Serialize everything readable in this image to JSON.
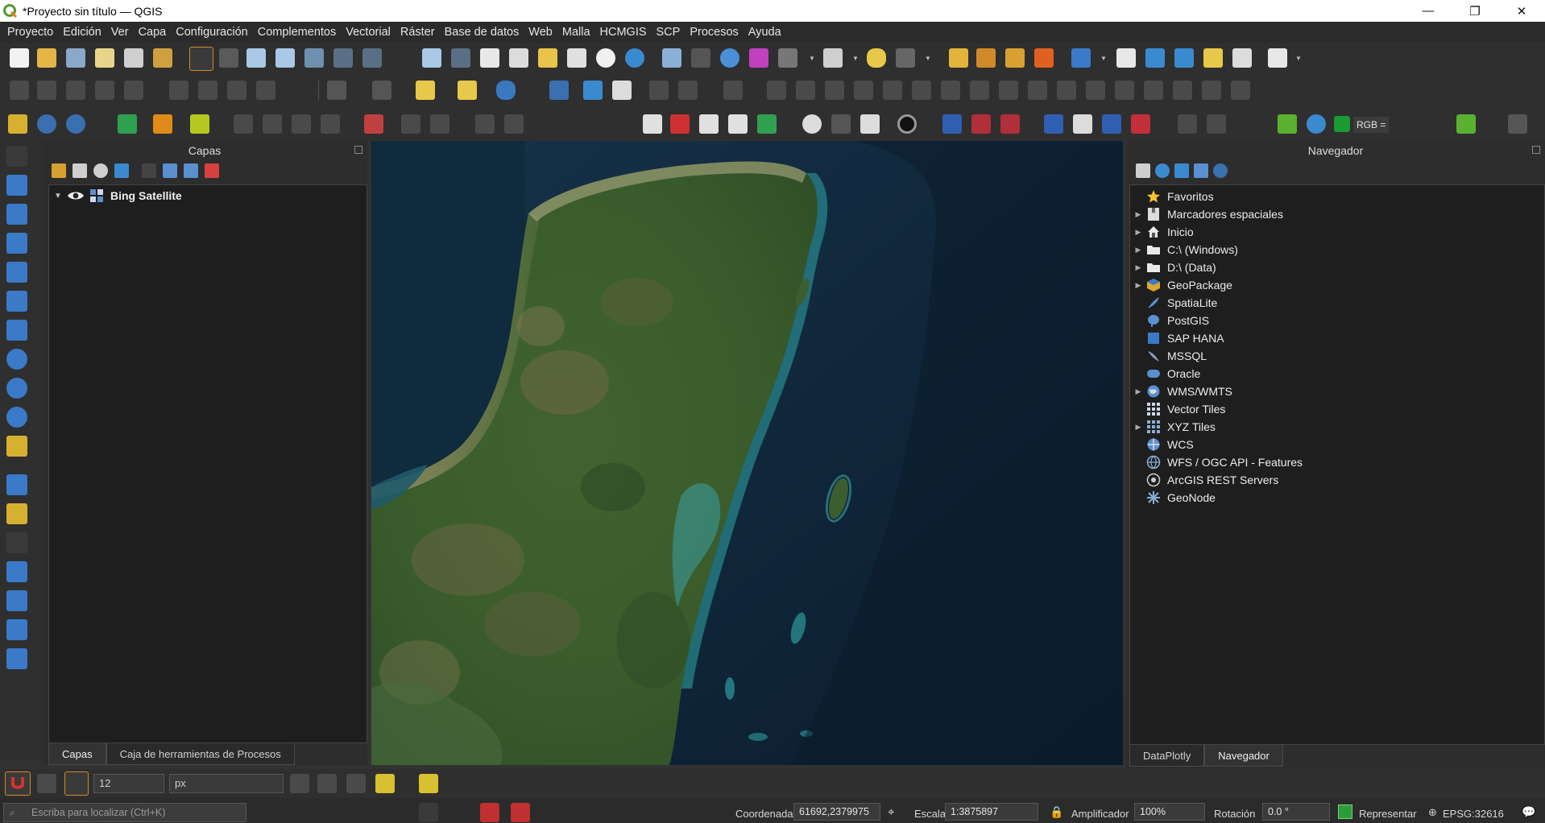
{
  "window": {
    "title": "*Proyecto sin título — QGIS",
    "controls": {
      "minimize": "—",
      "restore": "❐",
      "close": "✕"
    }
  },
  "menubar": {
    "items": [
      "Proyecto",
      "Edición",
      "Ver",
      "Capa",
      "Configuración",
      "Complementos",
      "Vectorial",
      "Ráster",
      "Base de datos",
      "Web",
      "Malla",
      "HCMGIS",
      "SCP",
      "Procesos",
      "Ayuda"
    ]
  },
  "toolbar": {
    "rgb_label": "RGB ="
  },
  "layers_panel": {
    "title": "Capas",
    "layers": [
      {
        "name": "Bing Satellite",
        "visible": true
      }
    ],
    "tabs": [
      "Capas",
      "Caja de herramientas de Procesos"
    ]
  },
  "browser_panel": {
    "title": "Navegador",
    "items": [
      {
        "label": "Favoritos",
        "icon": "star-icon",
        "expandable": false
      },
      {
        "label": "Marcadores espaciales",
        "icon": "bookmark-icon",
        "expandable": true
      },
      {
        "label": "Inicio",
        "icon": "home-icon",
        "expandable": true
      },
      {
        "label": "C:\\ (Windows)",
        "icon": "folder-icon",
        "expandable": true
      },
      {
        "label": "D:\\ (Data)",
        "icon": "folder-icon",
        "expandable": true
      },
      {
        "label": "GeoPackage",
        "icon": "geopackage-icon",
        "expandable": true
      },
      {
        "label": "SpatiaLite",
        "icon": "feather-icon",
        "expandable": false
      },
      {
        "label": "PostGIS",
        "icon": "elephant-icon",
        "expandable": false
      },
      {
        "label": "SAP HANA",
        "icon": "database-icon",
        "expandable": false
      },
      {
        "label": "MSSQL",
        "icon": "mssql-icon",
        "expandable": false
      },
      {
        "label": "Oracle",
        "icon": "oracle-icon",
        "expandable": false
      },
      {
        "label": "WMS/WMTS",
        "icon": "globe-icon",
        "expandable": true
      },
      {
        "label": "Vector Tiles",
        "icon": "grid-icon",
        "expandable": false
      },
      {
        "label": "XYZ Tiles",
        "icon": "grid-icon",
        "expandable": true
      },
      {
        "label": "WCS",
        "icon": "globe-icon",
        "expandable": false
      },
      {
        "label": "WFS / OGC API - Features",
        "icon": "globe-icon",
        "expandable": false
      },
      {
        "label": "ArcGIS REST Servers",
        "icon": "globe-icon",
        "expandable": false
      },
      {
        "label": "GeoNode",
        "icon": "geonode-icon",
        "expandable": false
      }
    ],
    "tabs": [
      "DataPlotly",
      "Navegador"
    ]
  },
  "bottom_tools": {
    "snap_tolerance": "12",
    "snap_units": "px"
  },
  "statusbar": {
    "locator_placeholder": "Escriba para localizar (Ctrl+K)",
    "coordinate_label": "Coordenada",
    "coordinate_value": "61692,2379975",
    "scale_label": "Escala",
    "scale_value": "1:3875897",
    "magnifier_label": "Amplificador",
    "magnifier_value": "100%",
    "rotation_label": "Rotación",
    "rotation_value": "0.0 °",
    "render_label": "Representar",
    "crs": "EPSG:32616"
  },
  "colors": {
    "ocean": "#0f2436",
    "land": "#3b5e2e",
    "coast": "#2b7f8f",
    "accent": "#2a9d3a"
  }
}
